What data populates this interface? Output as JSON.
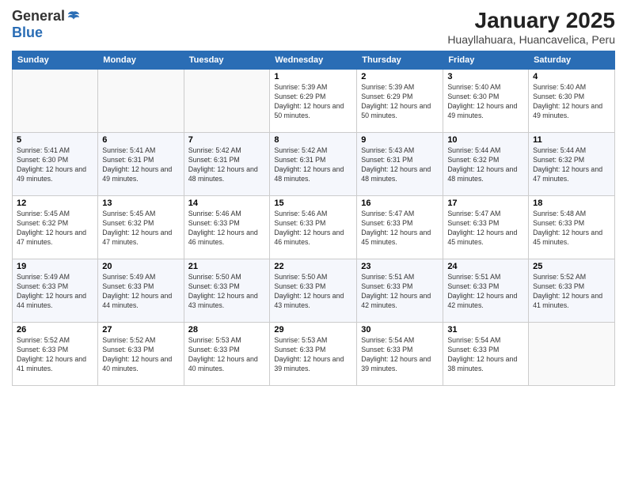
{
  "header": {
    "logo_line1": "General",
    "logo_line2": "Blue",
    "title": "January 2025",
    "subtitle": "Huayllahuara, Huancavelica, Peru"
  },
  "columns": [
    "Sunday",
    "Monday",
    "Tuesday",
    "Wednesday",
    "Thursday",
    "Friday",
    "Saturday"
  ],
  "weeks": [
    [
      {
        "day": "",
        "sunrise": "",
        "sunset": "",
        "daylight": ""
      },
      {
        "day": "",
        "sunrise": "",
        "sunset": "",
        "daylight": ""
      },
      {
        "day": "",
        "sunrise": "",
        "sunset": "",
        "daylight": ""
      },
      {
        "day": "1",
        "sunrise": "Sunrise: 5:39 AM",
        "sunset": "Sunset: 6:29 PM",
        "daylight": "Daylight: 12 hours and 50 minutes."
      },
      {
        "day": "2",
        "sunrise": "Sunrise: 5:39 AM",
        "sunset": "Sunset: 6:29 PM",
        "daylight": "Daylight: 12 hours and 50 minutes."
      },
      {
        "day": "3",
        "sunrise": "Sunrise: 5:40 AM",
        "sunset": "Sunset: 6:30 PM",
        "daylight": "Daylight: 12 hours and 49 minutes."
      },
      {
        "day": "4",
        "sunrise": "Sunrise: 5:40 AM",
        "sunset": "Sunset: 6:30 PM",
        "daylight": "Daylight: 12 hours and 49 minutes."
      }
    ],
    [
      {
        "day": "5",
        "sunrise": "Sunrise: 5:41 AM",
        "sunset": "Sunset: 6:30 PM",
        "daylight": "Daylight: 12 hours and 49 minutes."
      },
      {
        "day": "6",
        "sunrise": "Sunrise: 5:41 AM",
        "sunset": "Sunset: 6:31 PM",
        "daylight": "Daylight: 12 hours and 49 minutes."
      },
      {
        "day": "7",
        "sunrise": "Sunrise: 5:42 AM",
        "sunset": "Sunset: 6:31 PM",
        "daylight": "Daylight: 12 hours and 48 minutes."
      },
      {
        "day": "8",
        "sunrise": "Sunrise: 5:42 AM",
        "sunset": "Sunset: 6:31 PM",
        "daylight": "Daylight: 12 hours and 48 minutes."
      },
      {
        "day": "9",
        "sunrise": "Sunrise: 5:43 AM",
        "sunset": "Sunset: 6:31 PM",
        "daylight": "Daylight: 12 hours and 48 minutes."
      },
      {
        "day": "10",
        "sunrise": "Sunrise: 5:44 AM",
        "sunset": "Sunset: 6:32 PM",
        "daylight": "Daylight: 12 hours and 48 minutes."
      },
      {
        "day": "11",
        "sunrise": "Sunrise: 5:44 AM",
        "sunset": "Sunset: 6:32 PM",
        "daylight": "Daylight: 12 hours and 47 minutes."
      }
    ],
    [
      {
        "day": "12",
        "sunrise": "Sunrise: 5:45 AM",
        "sunset": "Sunset: 6:32 PM",
        "daylight": "Daylight: 12 hours and 47 minutes."
      },
      {
        "day": "13",
        "sunrise": "Sunrise: 5:45 AM",
        "sunset": "Sunset: 6:32 PM",
        "daylight": "Daylight: 12 hours and 47 minutes."
      },
      {
        "day": "14",
        "sunrise": "Sunrise: 5:46 AM",
        "sunset": "Sunset: 6:33 PM",
        "daylight": "Daylight: 12 hours and 46 minutes."
      },
      {
        "day": "15",
        "sunrise": "Sunrise: 5:46 AM",
        "sunset": "Sunset: 6:33 PM",
        "daylight": "Daylight: 12 hours and 46 minutes."
      },
      {
        "day": "16",
        "sunrise": "Sunrise: 5:47 AM",
        "sunset": "Sunset: 6:33 PM",
        "daylight": "Daylight: 12 hours and 45 minutes."
      },
      {
        "day": "17",
        "sunrise": "Sunrise: 5:47 AM",
        "sunset": "Sunset: 6:33 PM",
        "daylight": "Daylight: 12 hours and 45 minutes."
      },
      {
        "day": "18",
        "sunrise": "Sunrise: 5:48 AM",
        "sunset": "Sunset: 6:33 PM",
        "daylight": "Daylight: 12 hours and 45 minutes."
      }
    ],
    [
      {
        "day": "19",
        "sunrise": "Sunrise: 5:49 AM",
        "sunset": "Sunset: 6:33 PM",
        "daylight": "Daylight: 12 hours and 44 minutes."
      },
      {
        "day": "20",
        "sunrise": "Sunrise: 5:49 AM",
        "sunset": "Sunset: 6:33 PM",
        "daylight": "Daylight: 12 hours and 44 minutes."
      },
      {
        "day": "21",
        "sunrise": "Sunrise: 5:50 AM",
        "sunset": "Sunset: 6:33 PM",
        "daylight": "Daylight: 12 hours and 43 minutes."
      },
      {
        "day": "22",
        "sunrise": "Sunrise: 5:50 AM",
        "sunset": "Sunset: 6:33 PM",
        "daylight": "Daylight: 12 hours and 43 minutes."
      },
      {
        "day": "23",
        "sunrise": "Sunrise: 5:51 AM",
        "sunset": "Sunset: 6:33 PM",
        "daylight": "Daylight: 12 hours and 42 minutes."
      },
      {
        "day": "24",
        "sunrise": "Sunrise: 5:51 AM",
        "sunset": "Sunset: 6:33 PM",
        "daylight": "Daylight: 12 hours and 42 minutes."
      },
      {
        "day": "25",
        "sunrise": "Sunrise: 5:52 AM",
        "sunset": "Sunset: 6:33 PM",
        "daylight": "Daylight: 12 hours and 41 minutes."
      }
    ],
    [
      {
        "day": "26",
        "sunrise": "Sunrise: 5:52 AM",
        "sunset": "Sunset: 6:33 PM",
        "daylight": "Daylight: 12 hours and 41 minutes."
      },
      {
        "day": "27",
        "sunrise": "Sunrise: 5:52 AM",
        "sunset": "Sunset: 6:33 PM",
        "daylight": "Daylight: 12 hours and 40 minutes."
      },
      {
        "day": "28",
        "sunrise": "Sunrise: 5:53 AM",
        "sunset": "Sunset: 6:33 PM",
        "daylight": "Daylight: 12 hours and 40 minutes."
      },
      {
        "day": "29",
        "sunrise": "Sunrise: 5:53 AM",
        "sunset": "Sunset: 6:33 PM",
        "daylight": "Daylight: 12 hours and 39 minutes."
      },
      {
        "day": "30",
        "sunrise": "Sunrise: 5:54 AM",
        "sunset": "Sunset: 6:33 PM",
        "daylight": "Daylight: 12 hours and 39 minutes."
      },
      {
        "day": "31",
        "sunrise": "Sunrise: 5:54 AM",
        "sunset": "Sunset: 6:33 PM",
        "daylight": "Daylight: 12 hours and 38 minutes."
      },
      {
        "day": "",
        "sunrise": "",
        "sunset": "",
        "daylight": ""
      }
    ]
  ]
}
